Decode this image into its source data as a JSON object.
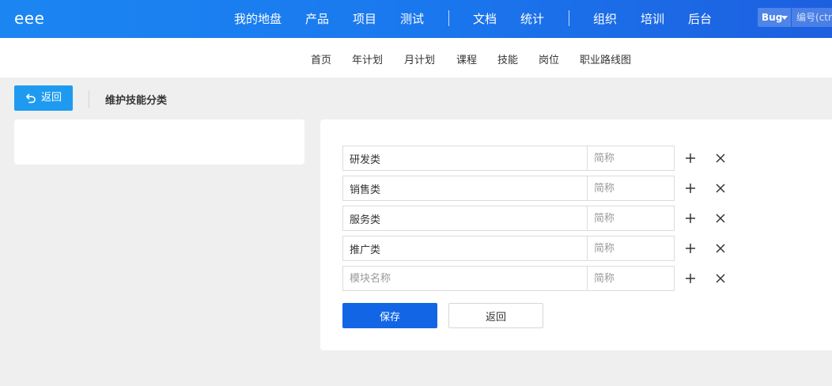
{
  "header": {
    "brand": "eee",
    "nav": [
      "我的地盘",
      "产品",
      "项目",
      "测试",
      "文档",
      "统计",
      "组织",
      "培训",
      "后台"
    ],
    "search_type": "Bug",
    "search_placeholder": "编号(ctrl+g)"
  },
  "subnav": [
    "首页",
    "年计划",
    "月计划",
    "课程",
    "技能",
    "岗位",
    "职业路线图"
  ],
  "toolbar": {
    "back_label": "返回",
    "title": "维护技能分类"
  },
  "form": {
    "name_placeholder": "模块名称",
    "short_placeholder": "简称",
    "rows": [
      {
        "name": "研发类",
        "short": ""
      },
      {
        "name": "销售类",
        "short": ""
      },
      {
        "name": "服务类",
        "short": ""
      },
      {
        "name": "推广类",
        "short": ""
      },
      {
        "name": "",
        "short": ""
      }
    ],
    "save_label": "保存",
    "return_label": "返回"
  },
  "colors": {
    "header_start": "#1b86f2",
    "header_end": "#1d5fe0",
    "back_button": "#1e9bf0",
    "save_button": "#1266e6"
  }
}
